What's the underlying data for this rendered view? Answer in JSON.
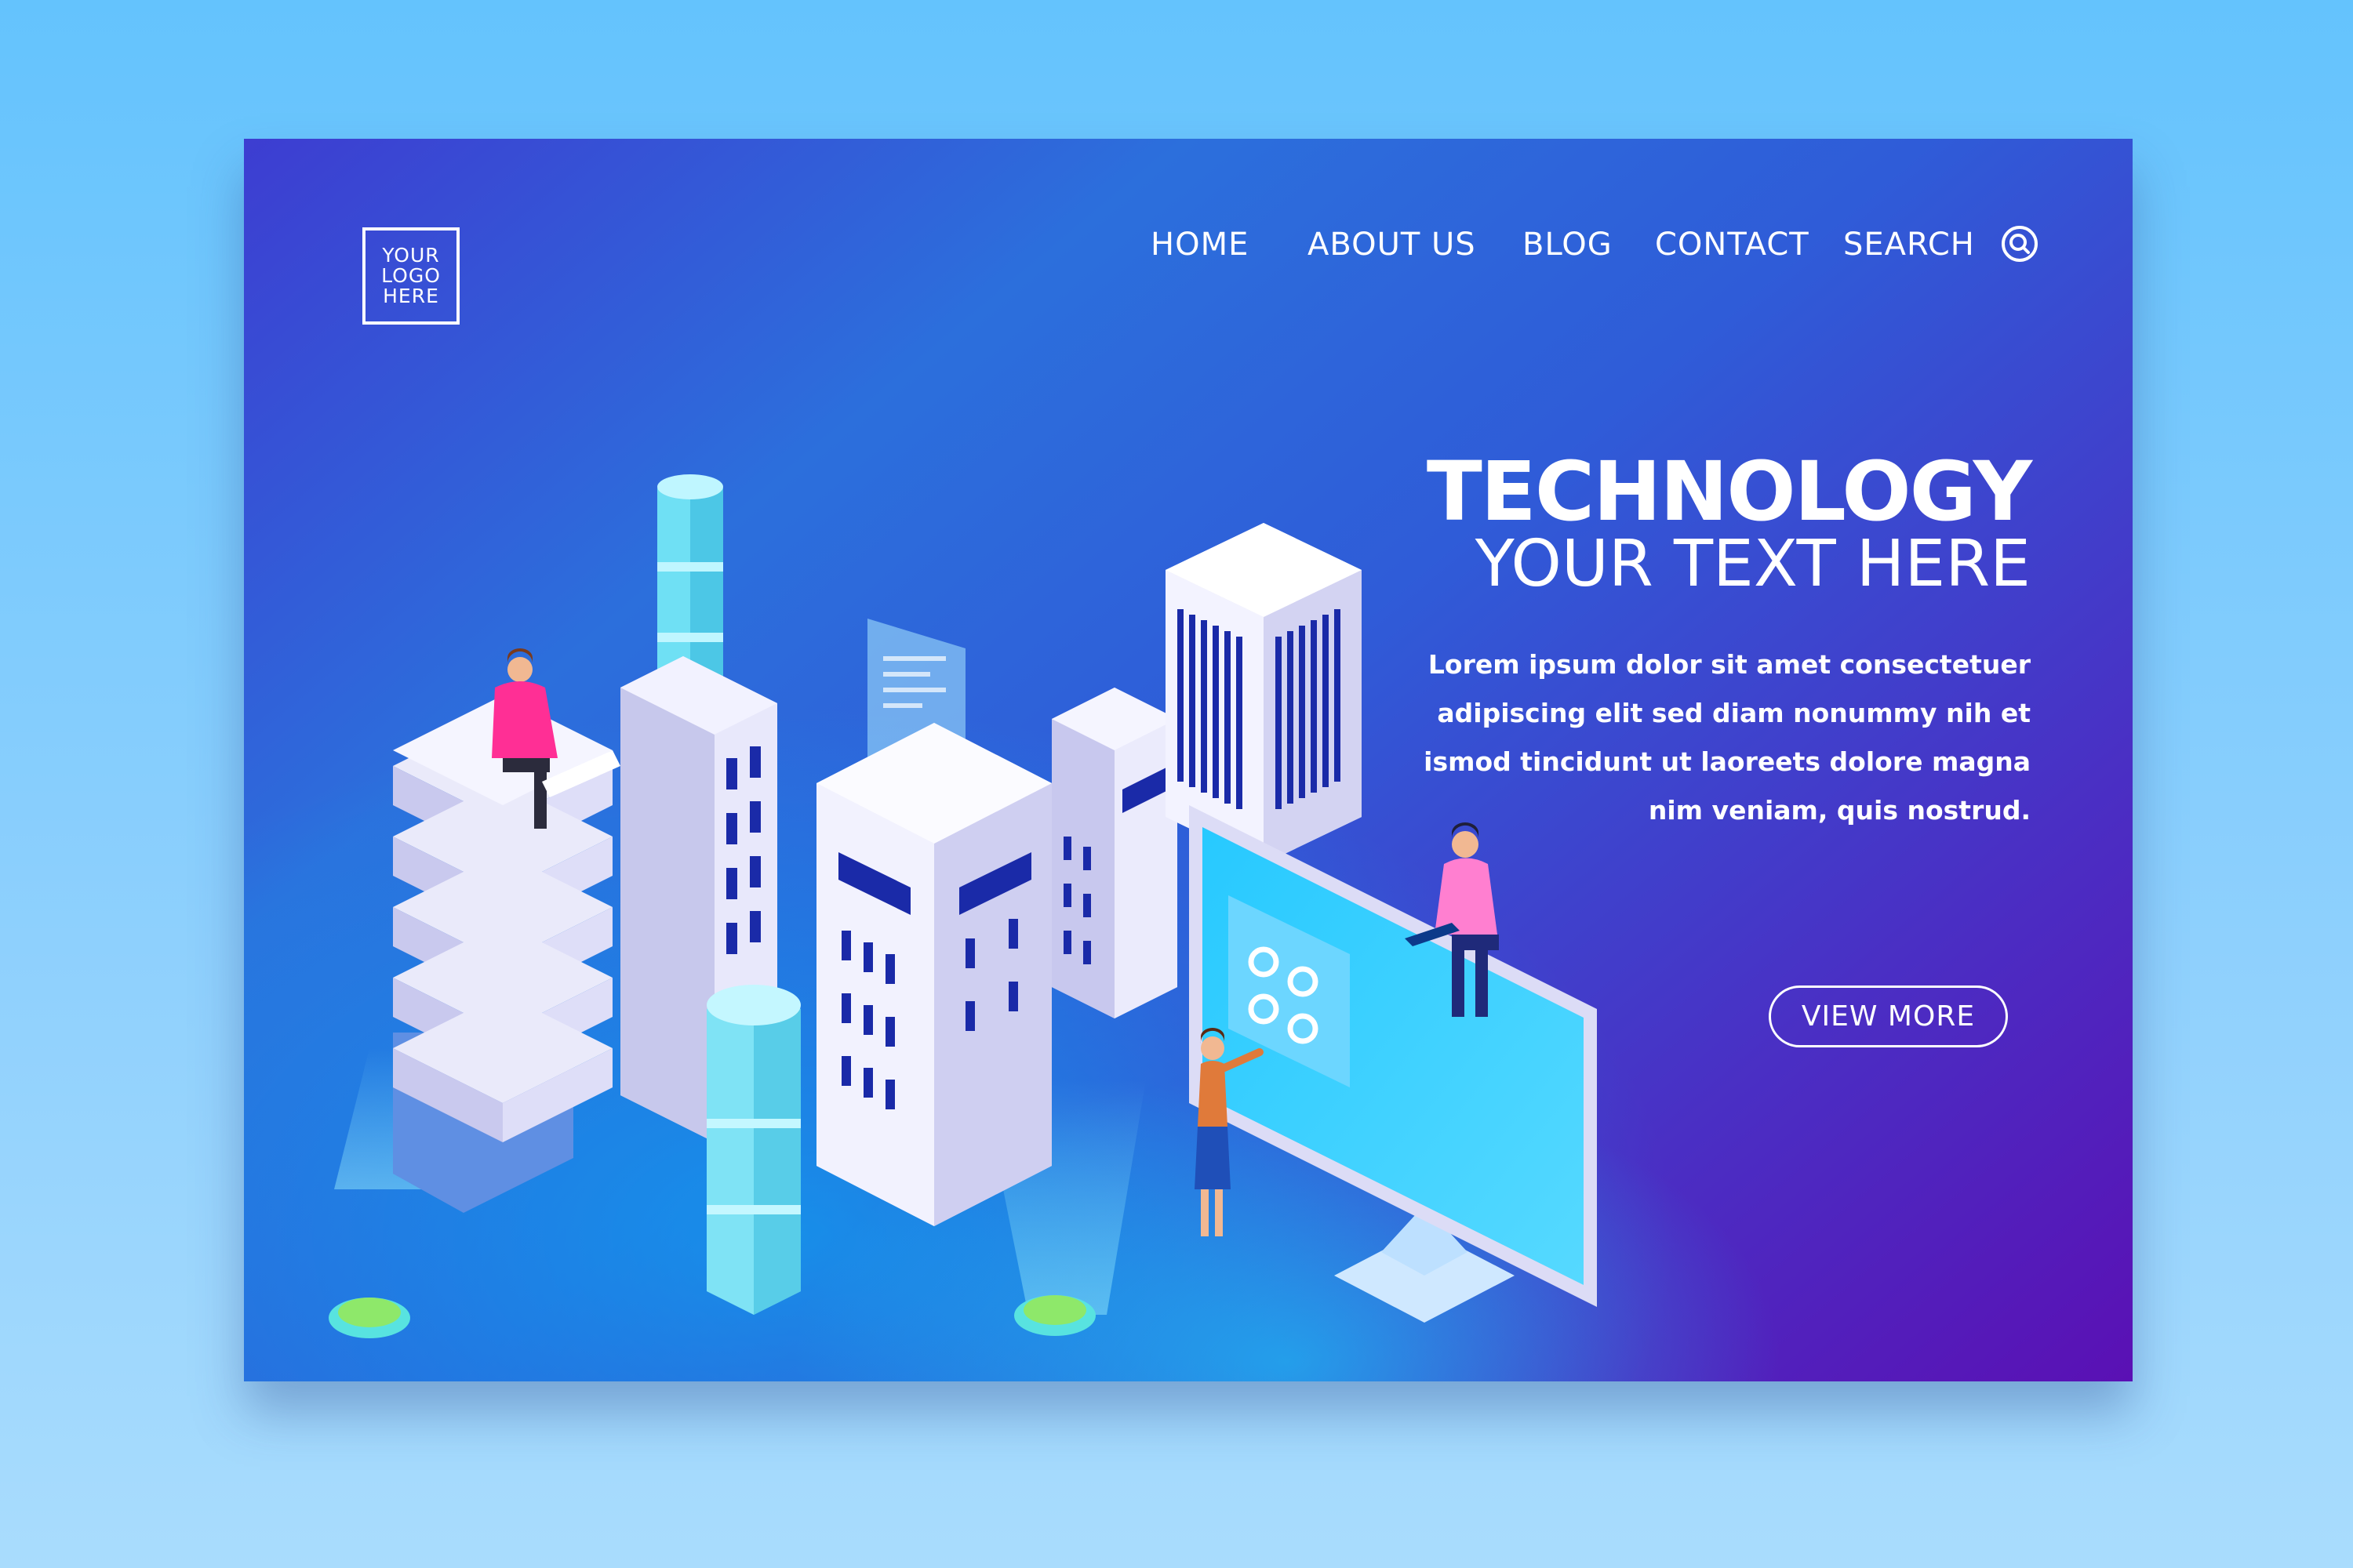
{
  "logo": {
    "text": "YOUR\nLOGO\nHERE"
  },
  "nav": {
    "items": [
      {
        "label": "HOME"
      },
      {
        "label": "ABOUT US"
      },
      {
        "label": "BLOG"
      },
      {
        "label": "CONTACT"
      },
      {
        "label": "SEARCH"
      }
    ],
    "search_icon": "search-icon"
  },
  "hero": {
    "title": "TECHNOLOGY",
    "subtitle": "YOUR TEXT HERE",
    "body_lines": [
      "Lorem ipsum dolor sit amet consectetuer",
      "adipiscing elit sed diam nonummy nih et",
      "ismod tincidunt ut laoreets dolore magna",
      "nim veniam, quis nostrud."
    ],
    "cta_label": "VIEW MORE"
  },
  "colors": {
    "page_background": "#7ccbfd",
    "card_gradient_start": "#3d3dd1",
    "card_gradient_mid": "#2c6fdc",
    "card_gradient_end": "#5a10b4",
    "text": "#ffffff",
    "accent_cyan": "#14dcff",
    "accent_pink": "#ff3ba0",
    "accent_green": "#7ee05a"
  },
  "illustration": {
    "subject": "isometric-city-technology",
    "elements": [
      "server-tower",
      "glass-tower",
      "office-building",
      "tall-office-building",
      "hologram-panel",
      "computer-monitor",
      "person-with-laptop",
      "person-with-tablet",
      "person-presenting",
      "spotlight"
    ]
  }
}
